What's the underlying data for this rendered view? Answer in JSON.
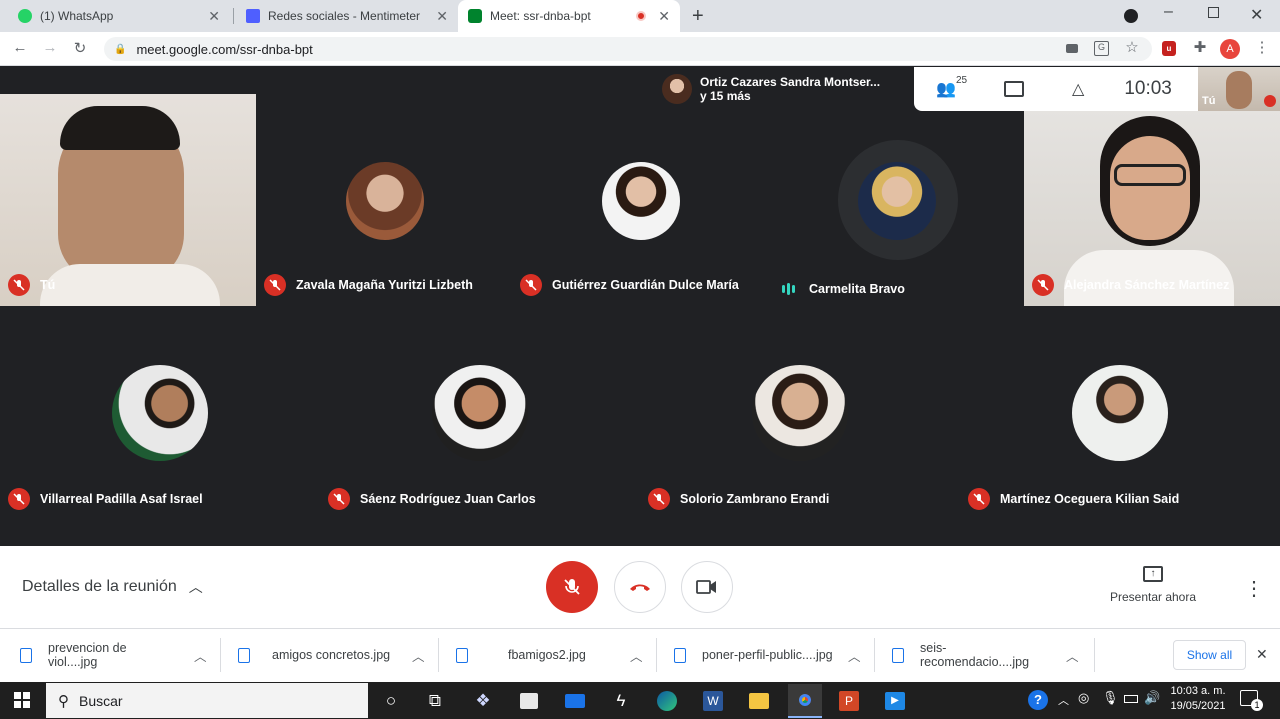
{
  "browser": {
    "tabs": [
      {
        "title": "(1) WhatsApp",
        "favicon": "whatsapp-icon",
        "color": "#25d366"
      },
      {
        "title": "Redes sociales - Mentimeter",
        "favicon": "mentimeter-icon",
        "color": "#4f5fff"
      },
      {
        "title": "Meet: ssr-dnba-bpt",
        "favicon": "meet-icon",
        "color": "#00832d"
      }
    ],
    "new_tab": "+",
    "url": "meet.google.com/ssr-dnba-bpt",
    "profile_initial": "A"
  },
  "meet": {
    "presenter": {
      "name": "Ortiz Cazares Sandra Montser...",
      "more": "y 15 más"
    },
    "participant_count": "25",
    "clock": "10:03",
    "self_label": "Tú",
    "participants": [
      {
        "name": "Tú",
        "muted": true,
        "video": true
      },
      {
        "name": "Zavala Magaña Yuritzi Lizbeth",
        "muted": true
      },
      {
        "name": "Gutiérrez Guardián Dulce María",
        "muted": true
      },
      {
        "name": "Carmelita Bravo",
        "muted": false,
        "speaking": true
      },
      {
        "name": "Alejandra Sánchez Martínez",
        "muted": true,
        "video": true
      },
      {
        "name": "Villarreal Padilla Asaf Israel",
        "muted": true
      },
      {
        "name": "Sáenz Rodríguez Juan Carlos",
        "muted": true
      },
      {
        "name": "Solorio Zambrano Erandi",
        "muted": true
      },
      {
        "name": "Martínez Oceguera Kilian Said",
        "muted": true
      }
    ],
    "details_label": "Detalles de la reunión",
    "present_label": "Presentar ahora"
  },
  "downloads": {
    "files": [
      "prevencion de viol....jpg",
      "amigos concretos.jpg",
      "fbamigos2.jpg",
      "poner-perfil-public....jpg",
      "seis-recomendacio....jpg"
    ],
    "show_all": "Show all"
  },
  "taskbar": {
    "search_placeholder": "Buscar",
    "time": "10:03 a. m.",
    "date": "19/05/2021",
    "notification_count": "1"
  },
  "colors": {
    "mute_red": "#d93025",
    "meet_bg": "#202124",
    "accent_blue": "#1a73e8"
  }
}
